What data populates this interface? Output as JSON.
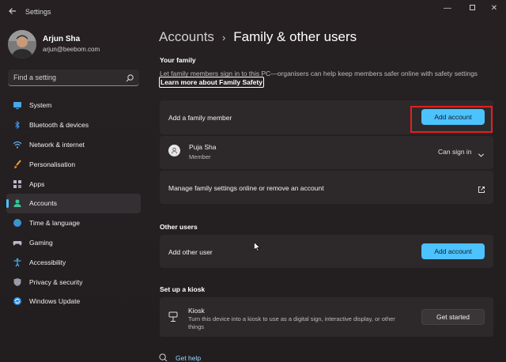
{
  "window": {
    "title": "Settings",
    "controls": {
      "minimize": "—",
      "close": "✕"
    }
  },
  "profile": {
    "name": "Arjun Sha",
    "email": "arjun@beebom.com"
  },
  "search": {
    "placeholder": "Find a setting"
  },
  "sidebar": {
    "items": [
      {
        "label": "System",
        "icon": "monitor-icon"
      },
      {
        "label": "Bluetooth & devices",
        "icon": "bluetooth-icon"
      },
      {
        "label": "Network & internet",
        "icon": "wifi-icon"
      },
      {
        "label": "Personalisation",
        "icon": "brush-icon"
      },
      {
        "label": "Apps",
        "icon": "apps-icon"
      },
      {
        "label": "Accounts",
        "icon": "person-icon",
        "active": true
      },
      {
        "label": "Time & language",
        "icon": "globe-icon"
      },
      {
        "label": "Gaming",
        "icon": "gamepad-icon"
      },
      {
        "label": "Accessibility",
        "icon": "accessibility-icon"
      },
      {
        "label": "Privacy & security",
        "icon": "shield-icon"
      },
      {
        "label": "Windows Update",
        "icon": "update-icon"
      }
    ]
  },
  "breadcrumb": {
    "parent": "Accounts",
    "separator": "›",
    "current": "Family & other users"
  },
  "family": {
    "section_title": "Your family",
    "description": "Let family members sign in to this PC—organisers can help keep members safer online with safety settings",
    "link": "Learn more about Family Safety",
    "add_member_label": "Add a family member",
    "add_member_button": "Add account",
    "member": {
      "name": "Puja Sha",
      "role": "Member",
      "status": "Can sign in"
    },
    "manage_label": "Manage family settings online or remove an account"
  },
  "other_users": {
    "section_title": "Other users",
    "add_label": "Add other user",
    "add_button": "Add account"
  },
  "kiosk": {
    "section_title": "Set up a kiosk",
    "title": "Kiosk",
    "description": "Turn this device into a kiosk to use as a digital sign, interactive display, or other things",
    "button": "Get started"
  },
  "footer": {
    "help_link": "Get help"
  },
  "colors": {
    "accent": "#4cc2ff",
    "highlight": "#e32020",
    "card": "#2d292b"
  }
}
